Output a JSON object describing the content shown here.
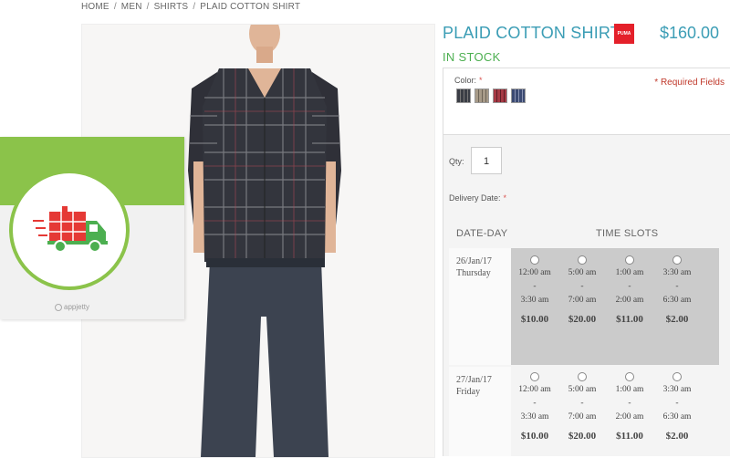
{
  "breadcrumb": [
    "HOME",
    "MEN",
    "SHIRTS",
    "PLAID COTTON SHIRT"
  ],
  "product": {
    "title": "PLAID COTTON SHIRT",
    "price": "$160.00",
    "stock": "IN STOCK",
    "brand_logo": "PUMA"
  },
  "badge": {
    "brand": "appjetty",
    "icon": "delivery-truck-icon"
  },
  "options": {
    "color_label": "Color:",
    "required_mark": "*",
    "required_note": "* Required Fields",
    "swatches": [
      {
        "name": "charcoal-plaid",
        "color": "#3a3d45"
      },
      {
        "name": "beige-plaid",
        "color": "#a79a88"
      },
      {
        "name": "red-plaid",
        "color": "#a63a45"
      },
      {
        "name": "navy-plaid",
        "color": "#3b4a72"
      }
    ]
  },
  "qty": {
    "label": "Qty:",
    "value": "1"
  },
  "delivery": {
    "label": "Delivery Date:",
    "required_mark": "*",
    "headers": {
      "day": "DATE-DAY",
      "slots": "TIME SLOTS"
    },
    "days": [
      {
        "date": "26/Jan/17",
        "weekday": "Thursday",
        "slots": [
          {
            "start": "12:00 am",
            "dash": "-",
            "end": "3:30 am",
            "cost": "$10.00"
          },
          {
            "start": "5:00 am",
            "dash": "-",
            "end": "7:00 am",
            "cost": "$20.00"
          },
          {
            "start": "1:00 am",
            "dash": "-",
            "end": "2:00 am",
            "cost": "$11.00"
          },
          {
            "start": "3:30 am",
            "dash": "-",
            "end": "6:30 am",
            "cost": "$2.00"
          }
        ]
      },
      {
        "date": "27/Jan/17",
        "weekday": "Friday",
        "slots": [
          {
            "start": "12:00 am",
            "dash": "-",
            "end": "3:30 am",
            "cost": "$10.00"
          },
          {
            "start": "5:00 am",
            "dash": "-",
            "end": "7:00 am",
            "cost": "$20.00"
          },
          {
            "start": "1:00 am",
            "dash": "-",
            "end": "2:00 am",
            "cost": "$11.00"
          },
          {
            "start": "3:30 am",
            "dash": "-",
            "end": "6:30 am",
            "cost": "$2.00"
          }
        ]
      }
    ]
  },
  "colors": {
    "accent": "#3b9db5",
    "in_stock": "#4caf50",
    "badge_green": "#8bc34a",
    "highlight_row": "#cbcbcb"
  }
}
